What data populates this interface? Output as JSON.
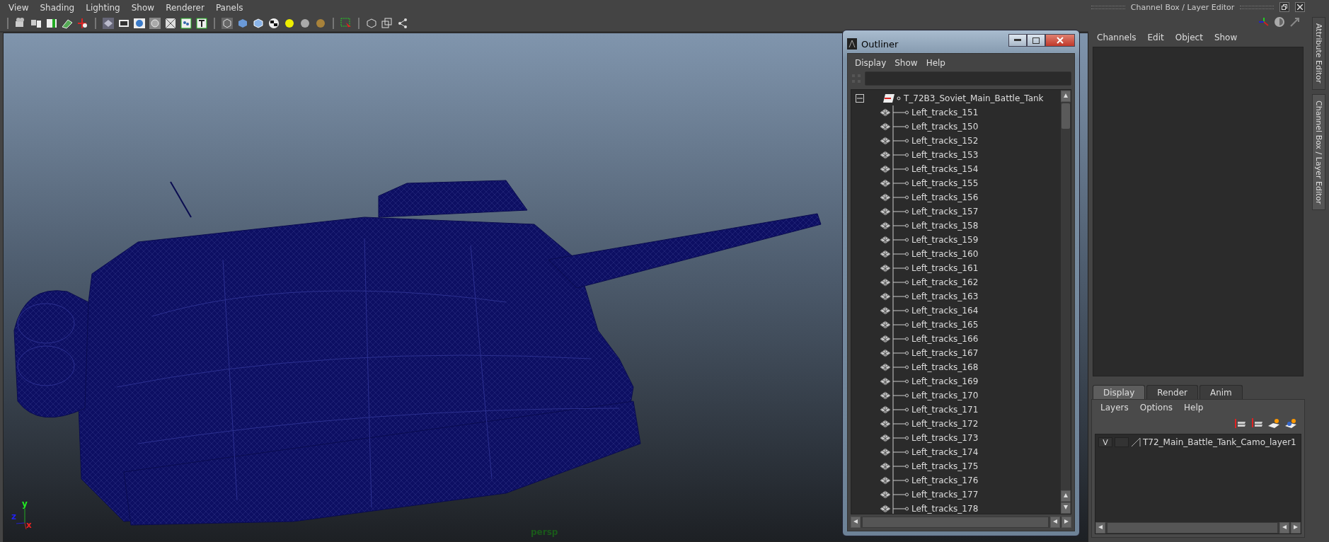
{
  "menubar": [
    "View",
    "Shading",
    "Lighting",
    "Show",
    "Renderer",
    "Panels"
  ],
  "viewport": {
    "camera_label": "persp",
    "axes": {
      "x": "x",
      "y": "y",
      "z": "z"
    }
  },
  "outliner": {
    "title": "Outliner",
    "menus": [
      "Display",
      "Show",
      "Help"
    ],
    "root": {
      "name": "T_72B3_Soviet_Main_Battle_Tank",
      "expanded": true,
      "children": [
        {
          "name": "Left_tracks_151"
        },
        {
          "name": "Left_tracks_150"
        },
        {
          "name": "Left_tracks_152"
        },
        {
          "name": "Left_tracks_153"
        },
        {
          "name": "Left_tracks_154"
        },
        {
          "name": "Left_tracks_155"
        },
        {
          "name": "Left_tracks_156"
        },
        {
          "name": "Left_tracks_157"
        },
        {
          "name": "Left_tracks_158"
        },
        {
          "name": "Left_tracks_159"
        },
        {
          "name": "Left_tracks_160"
        },
        {
          "name": "Left_tracks_161"
        },
        {
          "name": "Left_tracks_162"
        },
        {
          "name": "Left_tracks_163"
        },
        {
          "name": "Left_tracks_164"
        },
        {
          "name": "Left_tracks_165"
        },
        {
          "name": "Left_tracks_166"
        },
        {
          "name": "Left_tracks_167"
        },
        {
          "name": "Left_tracks_168"
        },
        {
          "name": "Left_tracks_169"
        },
        {
          "name": "Left_tracks_170"
        },
        {
          "name": "Left_tracks_171"
        },
        {
          "name": "Left_tracks_172"
        },
        {
          "name": "Left_tracks_173"
        },
        {
          "name": "Left_tracks_174"
        },
        {
          "name": "Left_tracks_175"
        },
        {
          "name": "Left_tracks_176"
        },
        {
          "name": "Left_tracks_177"
        },
        {
          "name": "Left_tracks_178"
        }
      ]
    }
  },
  "channel_box": {
    "title": "Channel Box / Layer Editor",
    "menus": [
      "Channels",
      "Edit",
      "Object",
      "Show"
    ]
  },
  "layer_editor": {
    "tabs": [
      {
        "label": "Display",
        "selected": true
      },
      {
        "label": "Render",
        "selected": false
      },
      {
        "label": "Anim",
        "selected": false
      }
    ],
    "menus": [
      "Layers",
      "Options",
      "Help"
    ],
    "layers": [
      {
        "visibility": "V",
        "name": "T72_Main_Battle_Tank_Camo_layer1"
      }
    ]
  },
  "side_tabs": [
    "Attribute Editor",
    "Channel Box / Layer Editor"
  ]
}
